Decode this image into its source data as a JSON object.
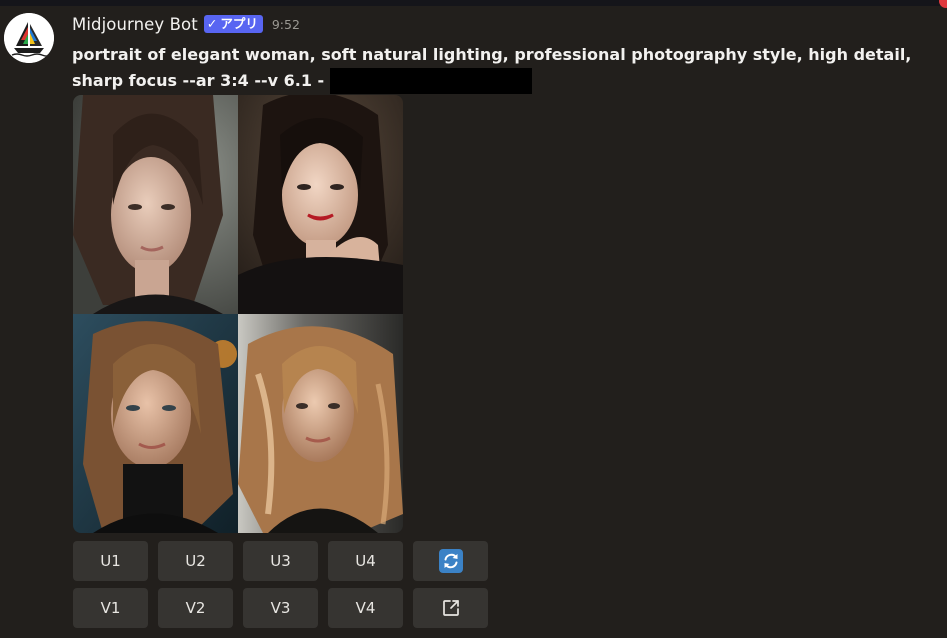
{
  "message": {
    "username": "Midjourney Bot",
    "badge": {
      "check": "✓",
      "label": "アプリ"
    },
    "timestamp": "9:52",
    "prompt": "portrait of elegant woman, soft natural lighting, professional photography style, high detail, sharp focus --ar 3:4 --v 6.1 -"
  },
  "images": [
    {
      "name": "portrait-1",
      "label": "Image 1"
    },
    {
      "name": "portrait-2",
      "label": "Image 2"
    },
    {
      "name": "portrait-3",
      "label": "Image 3"
    },
    {
      "name": "portrait-4",
      "label": "Image 4"
    }
  ],
  "buttons": {
    "row1": [
      "U1",
      "U2",
      "U3",
      "U4"
    ],
    "row2": [
      "V1",
      "V2",
      "V3",
      "V4"
    ],
    "reroll_icon": "refresh-icon",
    "web_icon": "external-link-icon"
  },
  "colors": {
    "background": "#221f1c",
    "button": "#363431",
    "badge": "#5865f2",
    "reroll": "#3b82c6",
    "notification": "#e0393e"
  }
}
